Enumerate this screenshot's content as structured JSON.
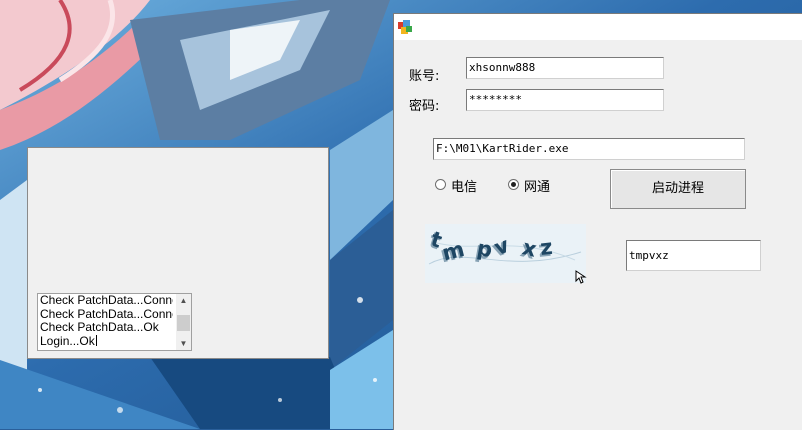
{
  "login_window": {
    "account_label": "账号:",
    "account_value": "xhsonnw888",
    "password_label": "密码:",
    "password_value": "********",
    "path_value": "F:\\M01\\KartRider.exe",
    "radio_options": [
      {
        "label": "电信",
        "checked": false
      },
      {
        "label": "网通",
        "checked": true
      }
    ],
    "start_button_label": "启动进程",
    "captcha_text": "tmpvxz",
    "captcha_input_value": "tmpvxz"
  },
  "log_window": {
    "log_lines": [
      "Check PatchData...Connect",
      "Check PatchData...Connect",
      "Check PatchData...Ok",
      "Login...Ok"
    ],
    "scroll_up_icon": "triangle-up",
    "scroll_down_icon": "triangle-down"
  },
  "colors": {
    "window_bg": "#f0f0f0",
    "wallpaper_blue": "#2a5f9a"
  }
}
